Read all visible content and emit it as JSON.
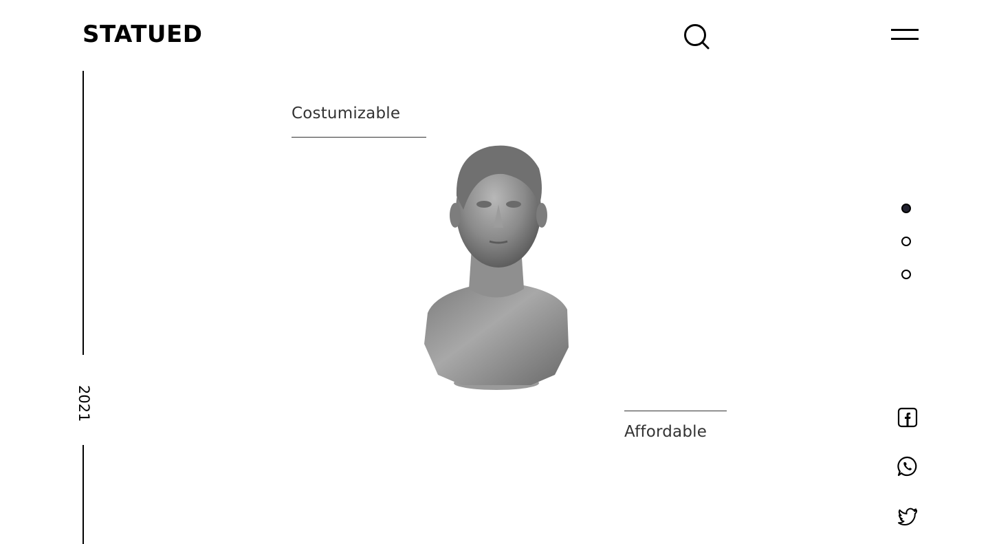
{
  "header": {
    "logo": "STATUED",
    "search_icon": "search-icon",
    "menu_icon": "hamburger-menu-icon"
  },
  "sidebar": {
    "year": "2021"
  },
  "hero": {
    "label_top": "Costumizable",
    "label_bottom": "Affordable",
    "image": "statue-bust"
  },
  "slider": {
    "slides": 3,
    "active_index": 0
  },
  "social": {
    "items": [
      "facebook-icon",
      "whatsapp-icon",
      "twitter-icon"
    ]
  },
  "colors": {
    "text": "#111111",
    "accent_dot": "#222230",
    "statue": "#8a8a8a",
    "background": "#ffffff"
  }
}
